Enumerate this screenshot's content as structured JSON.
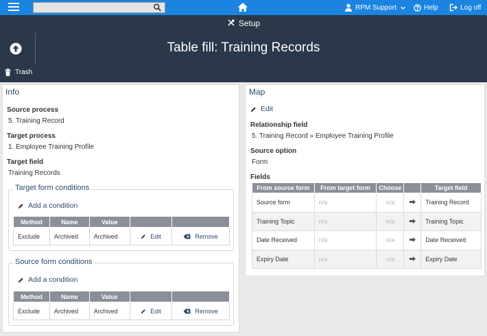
{
  "nav": {
    "support_label": "RPM Support",
    "help_label": "Help",
    "logoff_label": "Log off"
  },
  "header": {
    "section": "Setup",
    "title": "Table fill: Training Records",
    "trash_label": "Trash"
  },
  "info": {
    "title": "Info",
    "source_process_label": "Source process",
    "source_process_value": "5. Training Record",
    "target_process_label": "Target process",
    "target_process_value": "1. Employee Training Profile",
    "target_field_label": "Target field",
    "target_field_value": "Training Records",
    "target_conditions": {
      "legend": "Target form conditions",
      "add_label": "Add a condition",
      "headers": [
        "Method",
        "Name",
        "Value",
        "",
        ""
      ],
      "rows": [
        {
          "method": "Exclude",
          "name": "Archived",
          "value": "Archived",
          "edit": "Edit",
          "remove": "Remove"
        }
      ]
    },
    "source_conditions": {
      "legend": "Source form conditions",
      "add_label": "Add a condition",
      "headers": [
        "Method",
        "Name",
        "Value",
        "",
        ""
      ],
      "rows": [
        {
          "method": "Exclude",
          "name": "Archived",
          "value": "Archived",
          "edit": "Edit",
          "remove": "Remove"
        }
      ]
    }
  },
  "map": {
    "title": "Map",
    "edit_label": "Edit",
    "relationship_label": "Relationship field",
    "relationship_value": "5. Training Record » Employee Training Profile",
    "source_option_label": "Source option",
    "source_option_value": "Form",
    "fields_label": "Fields",
    "fields_headers": [
      "From source form",
      "From target form",
      "Choose",
      "",
      "Target field"
    ],
    "fields_rows": [
      {
        "source": "Source form",
        "target": "n/a",
        "choose": "n/a",
        "target_field": "Training Record"
      },
      {
        "source": "Training Topic",
        "target": "n/a",
        "choose": "n/a",
        "target_field": "Training Topic"
      },
      {
        "source": "Date Received",
        "target": "n/a",
        "choose": "n/a",
        "target_field": "Date Received"
      },
      {
        "source": "Expiry Date",
        "target": "n/a",
        "choose": "n/a",
        "target_field": "Expiry Date"
      }
    ]
  },
  "icons": {
    "menu": "hamburger-menu-icon",
    "search": "search-icon",
    "home": "home-icon",
    "user": "user-icon",
    "help": "help-icon",
    "logoff": "logoff-icon",
    "setup": "tools-icon",
    "up": "arrow-up-circle-icon",
    "trash": "trash-icon",
    "pencil": "pencil-icon",
    "remove": "backspace-icon",
    "arrow": "arrow-right-icon"
  },
  "colors": {
    "topbar": "#1b84e0",
    "header": "#2b3849",
    "link": "#2b4a6b",
    "table_header": "#8a8f99"
  }
}
